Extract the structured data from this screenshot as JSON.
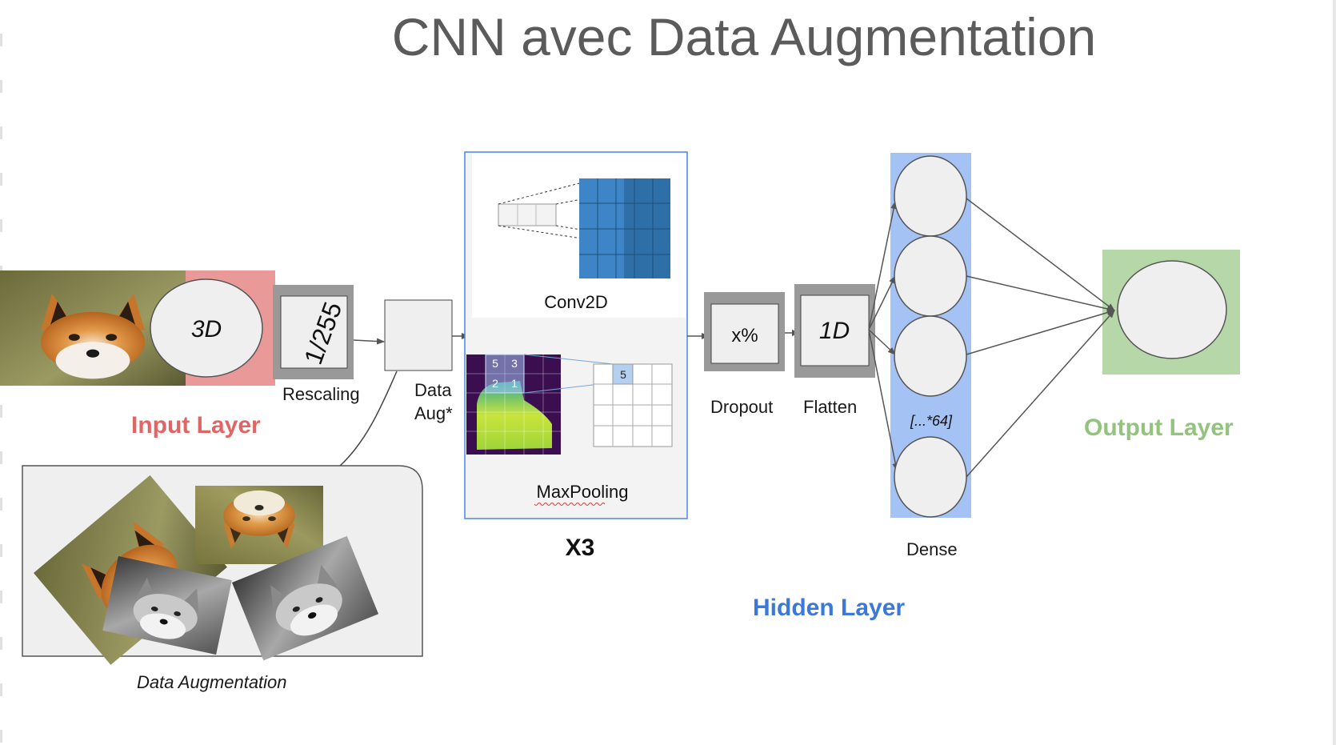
{
  "title": "CNN avec Data Augmentation",
  "input": {
    "dim_label": "3D",
    "layer_label": "Input Layer",
    "color": "#e06666"
  },
  "rescaling": {
    "value_label": "1/255",
    "caption": "Rescaling"
  },
  "data_aug": {
    "caption_line1": "Data",
    "caption_line2": "Aug*",
    "panel_caption": "Data Augmentation"
  },
  "conv_block": {
    "conv_caption": "Conv2D",
    "pool_caption": "MaxPooling",
    "repeat_label": "X3",
    "pool_grid_values": [
      "5",
      "3",
      "2",
      "1"
    ],
    "pool_output_value": "5",
    "border_color": "#4a86e8"
  },
  "dropout": {
    "value_label": "x%",
    "caption": "Dropout"
  },
  "flatten": {
    "value_label": "1D",
    "caption": "Flatten"
  },
  "dense": {
    "count_label": "[...*64]",
    "caption": "Dense",
    "color": "#a4c2f4"
  },
  "hidden_layer_label": "Hidden Layer",
  "hidden_color": "#3c78d8",
  "output": {
    "layer_label": "Output Layer",
    "color": "#93c47d",
    "box_color": "#b6d7a8"
  }
}
